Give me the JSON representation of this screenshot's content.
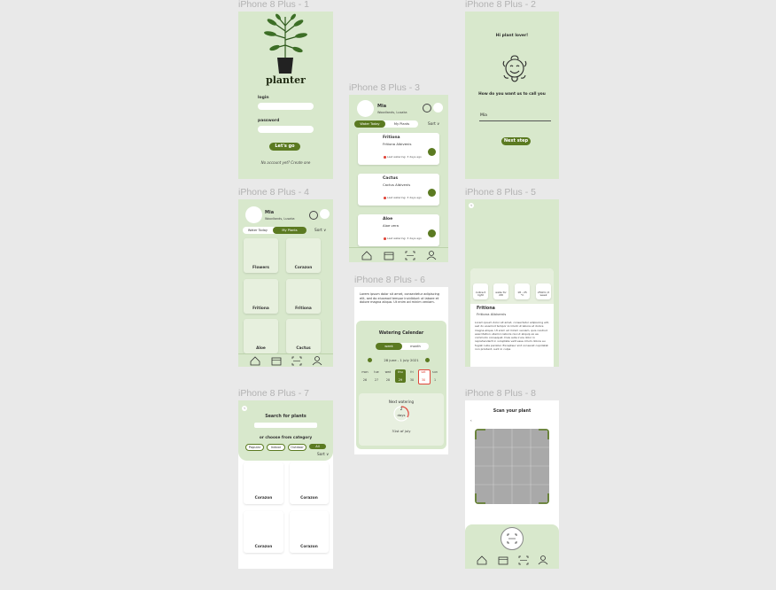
{
  "frames": {
    "f1": "iPhone 8 Plus - 1",
    "f2": "iPhone 8 Plus - 2",
    "f3": "iPhone 8 Plus - 3",
    "f4": "iPhone 8 Plus - 4",
    "f5": "iPhone 8 Plus - 5",
    "f6": "iPhone 8 Plus - 6",
    "f7": "iPhone 8 Plus - 7",
    "f8": "iPhone 8 Plus - 8"
  },
  "colors": {
    "bg": "#e9e9e9",
    "panel": "#d8e8cc",
    "accent": "#5b7a21",
    "alert": "#e0463a"
  },
  "login": {
    "brand": "planter",
    "login_label": "login",
    "password_label": "password",
    "submit": "Let's go",
    "signup": "No account yet? Create one"
  },
  "greet": {
    "title": "Hi plant lover!",
    "question": "How do you want us to call you",
    "name_value": "Mia",
    "next": "Next step"
  },
  "profile": {
    "name": "Mia",
    "location": "Woodlands, Lusaka"
  },
  "tabs": {
    "water": "Water Today",
    "my": "My Plants",
    "sort": "Sort ∨"
  },
  "watering_list": [
    {
      "name": "Fritiona",
      "latin": "Fritiona Albivenis",
      "status": "Last watering: 3 days ago"
    },
    {
      "name": "Cactus",
      "latin": "Cactus Albivenis",
      "status": "Last watering: 3 days ago"
    },
    {
      "name": "Aloe",
      "latin": "Aloe vera",
      "status": "Last watering: 3 days ago"
    }
  ],
  "my_plants": [
    "Flowers",
    "Corazon",
    "Fritiona",
    "Fritiona",
    "Aloe",
    "Cactus"
  ],
  "detail": {
    "chips": [
      "indirect light",
      "wate for 2W",
      "18 - 25 °C",
      "250ml /2 week"
    ],
    "name": "Fritiona",
    "latin": "Fritiona Albivenis",
    "desc": "Lorem ipsum dolor sit amet, consectetur adipiscing elit, sed do eiusmod tempor incidunt ut labore et dolore magna aliqua. Ut enim ad minim veniam, quis nostrud exercitation ullamco laboris nisi ut aliquip ex ea commodo consequat. Duis aute irure dolor in reprehenderit in voluptate velit esse cillum dolore eu fugiat nulla pariatur. Excepteur sint occaecat cupidatat non proident, sunt in culpa"
  },
  "calendar": {
    "intro": "Lorem ipsum dolor sit amet, consectetur adipiscing elit, sed do eiusmod tempor incididunt ut labore et dolore magna aliqua. Ut enim ad minim veniam.",
    "title": "Watering Calendar",
    "week": "week",
    "month": "month",
    "range": "28 june - 1 july 2021",
    "days": [
      "mon",
      "tue",
      "wed",
      "thu",
      "fri",
      "sat",
      "sun"
    ],
    "dates": [
      "26",
      "27",
      "28",
      "29",
      "30",
      "30",
      "1"
    ],
    "next_label": "Next watering",
    "days_num": "2",
    "days_word": "days",
    "next_date": "31st of july"
  },
  "search": {
    "title": "Search for plants",
    "category": "or choose from category",
    "chips": [
      "Popular",
      "Indoor",
      "Outdoor",
      "All"
    ],
    "sort": "Sort ∨",
    "results": [
      "Corazon",
      "Corazon",
      "Corazon",
      "Corazon"
    ]
  },
  "scan": {
    "title": "Scan your plant"
  }
}
